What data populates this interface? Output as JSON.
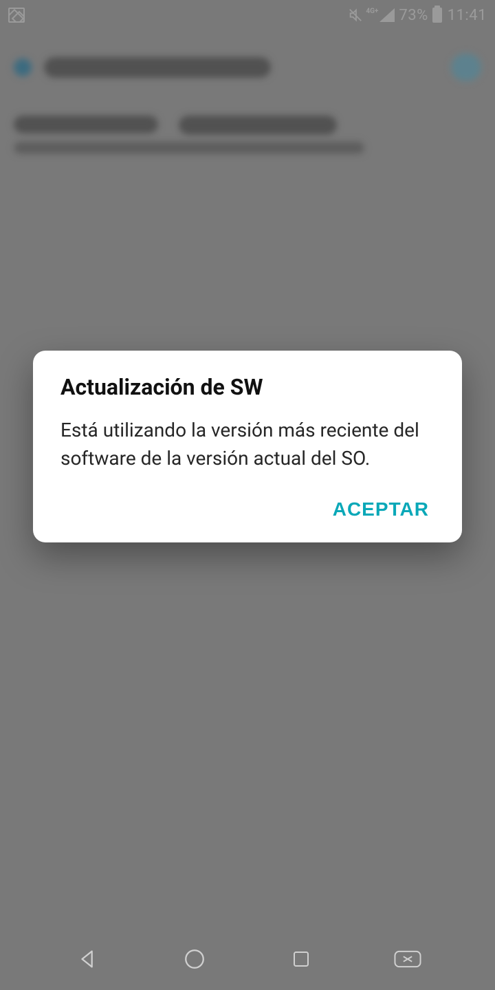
{
  "status_bar": {
    "network_label": "4G+",
    "battery_percent_text": "73%",
    "clock": "11:41"
  },
  "dialog": {
    "title": "Actualización de SW",
    "body": "Está utilizando la versión más reciente del software de la versión actual del SO.",
    "accept_label": "ACEPTAR"
  },
  "colors": {
    "accent": "#0aa8b8"
  }
}
